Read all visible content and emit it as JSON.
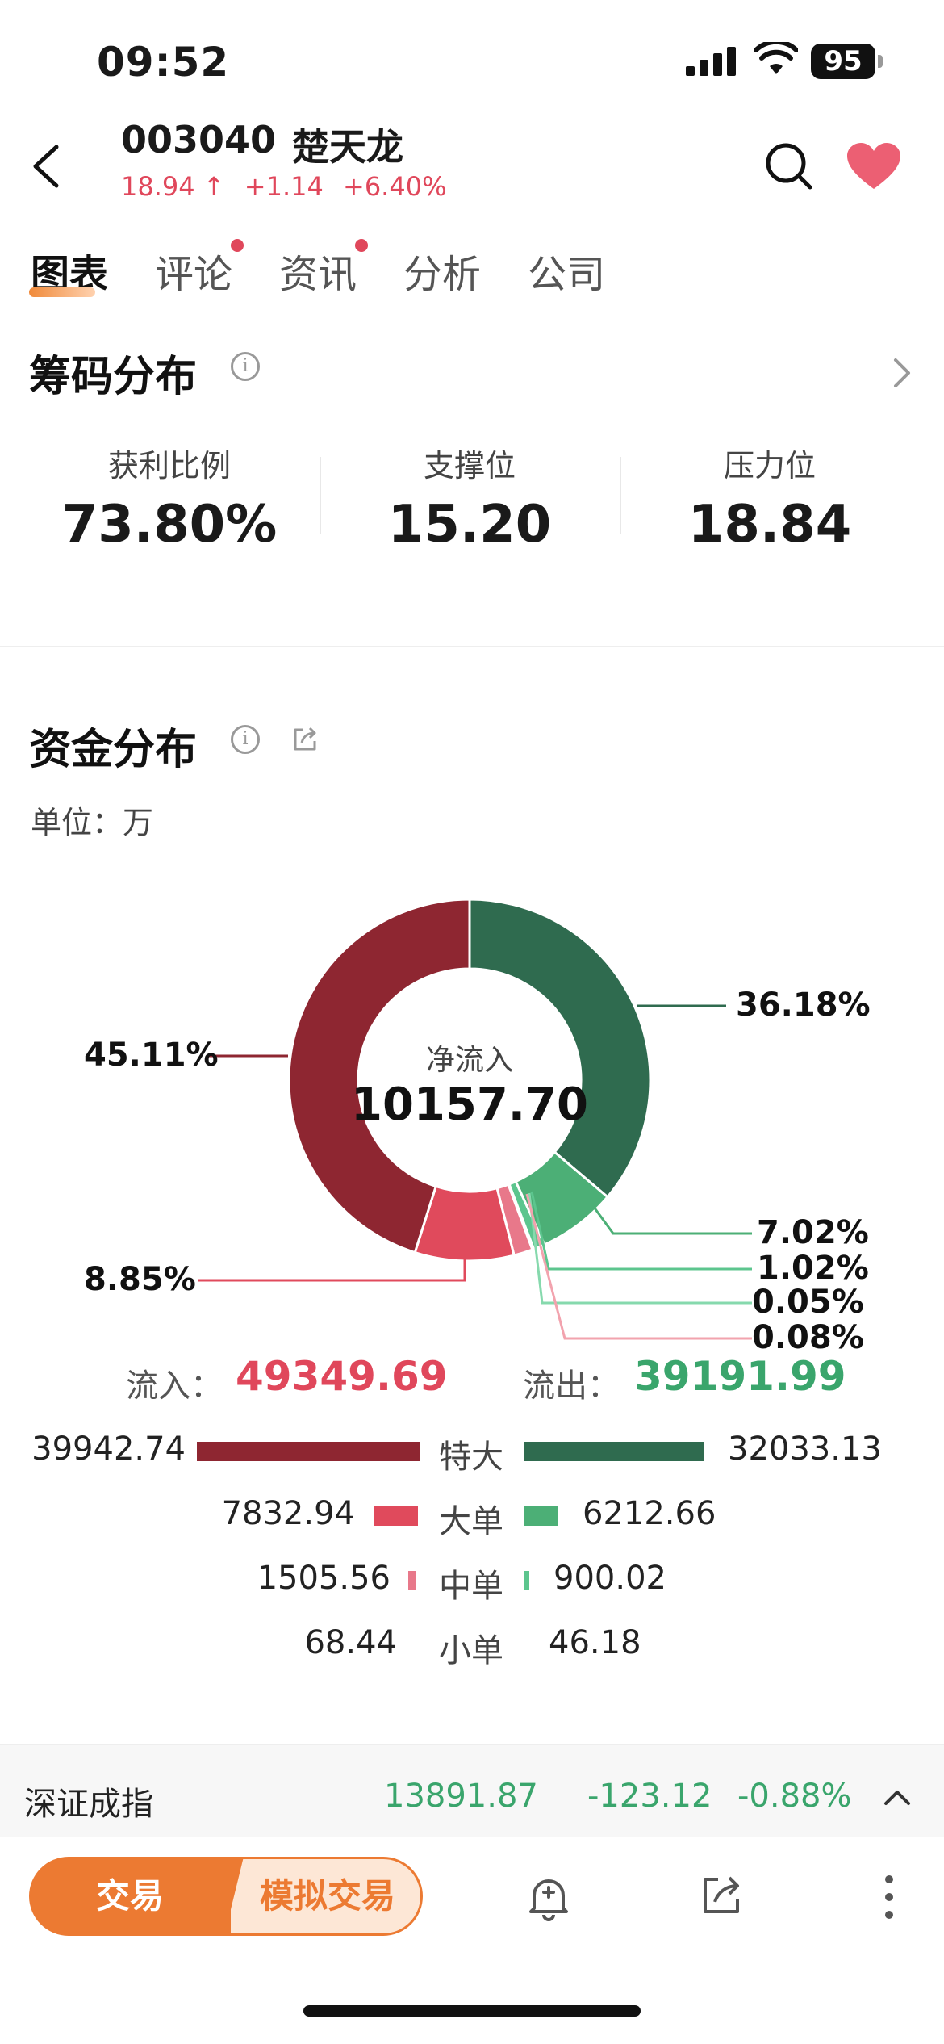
{
  "status": {
    "time": "09:52",
    "battery": "95"
  },
  "stock": {
    "code": "003040",
    "name": "楚天龙",
    "price": "18.94",
    "arrow": "↑",
    "change": "+1.14",
    "change_pct": "+6.40%"
  },
  "tabs": [
    {
      "label": "图表",
      "active": true,
      "dot": false
    },
    {
      "label": "评论",
      "active": false,
      "dot": true
    },
    {
      "label": "资讯",
      "active": false,
      "dot": true
    },
    {
      "label": "分析",
      "active": false,
      "dot": false
    },
    {
      "label": "公司",
      "active": false,
      "dot": false
    }
  ],
  "chips": {
    "title": "筹码分布",
    "metrics": [
      {
        "label": "获利比例",
        "value": "73.80%"
      },
      {
        "label": "支撑位",
        "value": "15.20"
      },
      {
        "label": "压力位",
        "value": "18.84"
      }
    ]
  },
  "funds": {
    "title": "资金分布",
    "unit": "单位：万",
    "center_label": "净流入",
    "center_value": "10157.70",
    "inflow_label": "流入：",
    "inflow_value": "49349.69",
    "outflow_label": "流出：",
    "outflow_value": "39191.99",
    "rows": [
      {
        "label": "特大",
        "in": "39942.74",
        "out": "32033.13"
      },
      {
        "label": "大单",
        "in": "7832.94",
        "out": "6212.66"
      },
      {
        "label": "中单",
        "in": "1505.56",
        "out": "900.02"
      },
      {
        "label": "小单",
        "in": "68.44",
        "out": "46.18"
      }
    ]
  },
  "chart_data": {
    "type": "pie",
    "donut": true,
    "slices": [
      {
        "label": "36.18%",
        "value": 36.18,
        "color": "#2f6b4f"
      },
      {
        "label": "7.02%",
        "value": 7.02,
        "color": "#4caf76"
      },
      {
        "label": "1.02%",
        "value": 1.02,
        "color": "#5cc58e"
      },
      {
        "label": "0.05%",
        "value": 0.05,
        "color": "#86d9ad"
      },
      {
        "label": "0.08%",
        "value": 0.08,
        "color": "#f2a3ae"
      },
      {
        "label": "1.69%",
        "value": 1.69,
        "color": "#e8788a"
      },
      {
        "label": "8.85%",
        "value": 8.85,
        "color": "#e04a5c"
      },
      {
        "label": "45.11%",
        "value": 45.11,
        "color": "#8e2631"
      }
    ]
  },
  "index": {
    "name": "深证成指",
    "value": "13891.87",
    "change": "-123.12",
    "pct": "-0.88%"
  },
  "actions": {
    "trade": "交易",
    "sim_trade": "模拟交易"
  },
  "colors": {
    "up": "#e0475b",
    "down": "#3aa56c",
    "accent": "#ec7a32"
  }
}
